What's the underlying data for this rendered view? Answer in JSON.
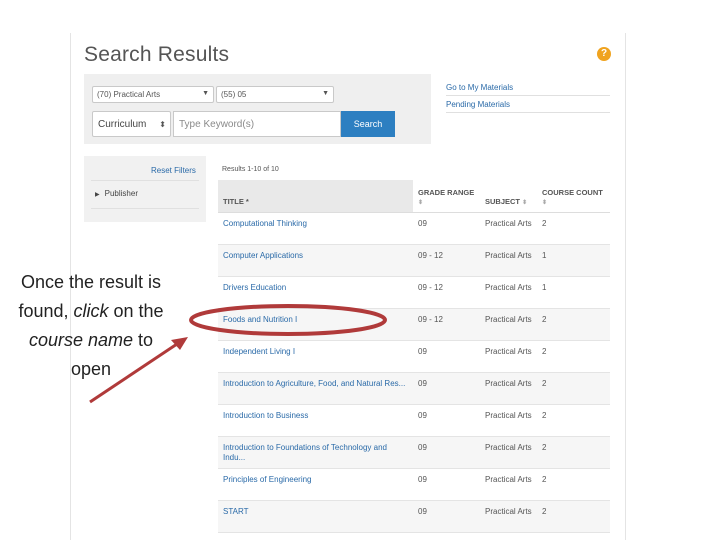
{
  "header": {
    "title": "Search Results",
    "help_label": "?"
  },
  "search": {
    "subject_select": "(70) Practical Arts",
    "grade_select": "(55) 05",
    "type_select": "Curriculum",
    "keyword_placeholder": "Type Keyword(s)",
    "search_label": "Search"
  },
  "side_links": {
    "go_to_materials": "Go to My Materials",
    "pending_materials": "Pending Materials"
  },
  "filters": {
    "reset_label": "Reset Filters",
    "publisher_label": "Publisher"
  },
  "results": {
    "count_text": "Results 1-10 of 10",
    "columns": [
      "TITLE *",
      "GRADE RANGE",
      "SUBJECT",
      "COURSE COUNT"
    ],
    "rows": [
      {
        "title": "Computational Thinking",
        "grade": "09",
        "subject": "Practical Arts",
        "count": "2"
      },
      {
        "title": "Computer Applications",
        "grade": "09 - 12",
        "subject": "Practical Arts",
        "count": "1"
      },
      {
        "title": "Drivers Education",
        "grade": "09 - 12",
        "subject": "Practical Arts",
        "count": "1"
      },
      {
        "title": "Foods and Nutrition I",
        "grade": "09 - 12",
        "subject": "Practical Arts",
        "count": "2"
      },
      {
        "title": "Independent Living I",
        "grade": "09",
        "subject": "Practical Arts",
        "count": "2"
      },
      {
        "title": "Introduction to Agriculture, Food, and Natural Res...",
        "grade": "09",
        "subject": "Practical Arts",
        "count": "2"
      },
      {
        "title": "Introduction to Business",
        "grade": "09",
        "subject": "Practical Arts",
        "count": "2"
      },
      {
        "title": "Introduction to Foundations of Technology and Indu...",
        "grade": "09",
        "subject": "Practical Arts",
        "count": "2"
      },
      {
        "title": "Principles of Engineering",
        "grade": "09",
        "subject": "Practical Arts",
        "count": "2"
      },
      {
        "title": "START",
        "grade": "09",
        "subject": "Practical Arts",
        "count": "2"
      }
    ]
  },
  "callout": {
    "part1": "Once the result is found, ",
    "click": "click",
    "part2": " on the ",
    "course": "course",
    "name": "name",
    "part3": " to open"
  },
  "colors": {
    "accent": "#2d7fc1",
    "annotation": "#b03a3a",
    "help": "#f0a31f"
  },
  "icons": [
    "help-icon",
    "caret-down-icon",
    "sort-icon",
    "triangle-right-icon",
    "arrow-icon"
  ]
}
